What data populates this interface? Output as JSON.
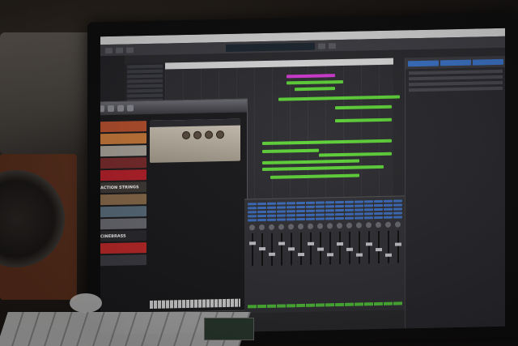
{
  "scene": {
    "description_colors": {
      "wall": "#2a241f",
      "speaker_cabinet": "#5a2f1c",
      "monitor_bezel": "#0d0d0e",
      "daw_background": "#2b2b2f",
      "region_green": "#5fd13a",
      "region_magenta": "#d33bd3",
      "mixer_blue": "#3d6fbf"
    }
  },
  "plugin": {
    "libraries": [
      {
        "label": "",
        "color": "#b8502e"
      },
      {
        "label": "",
        "color": "#c97a3a"
      },
      {
        "label": "",
        "color": "#a9a39a"
      },
      {
        "label": "",
        "color": "#7a2b2b"
      },
      {
        "label": "",
        "color": "#b8202a"
      },
      {
        "label": "ACTION STRINGS",
        "color": "#3f3a36"
      },
      {
        "label": "",
        "color": "#8a6b4a"
      },
      {
        "label": "",
        "color": "#5b6e7c"
      },
      {
        "label": "",
        "color": "#6c6c74"
      },
      {
        "label": "CINEBRASS",
        "color": "#2c2c30"
      },
      {
        "label": "",
        "color": "#c42a2a"
      },
      {
        "label": "",
        "color": "#3d3d44"
      }
    ]
  },
  "mixer": {
    "channel_count": 16
  }
}
